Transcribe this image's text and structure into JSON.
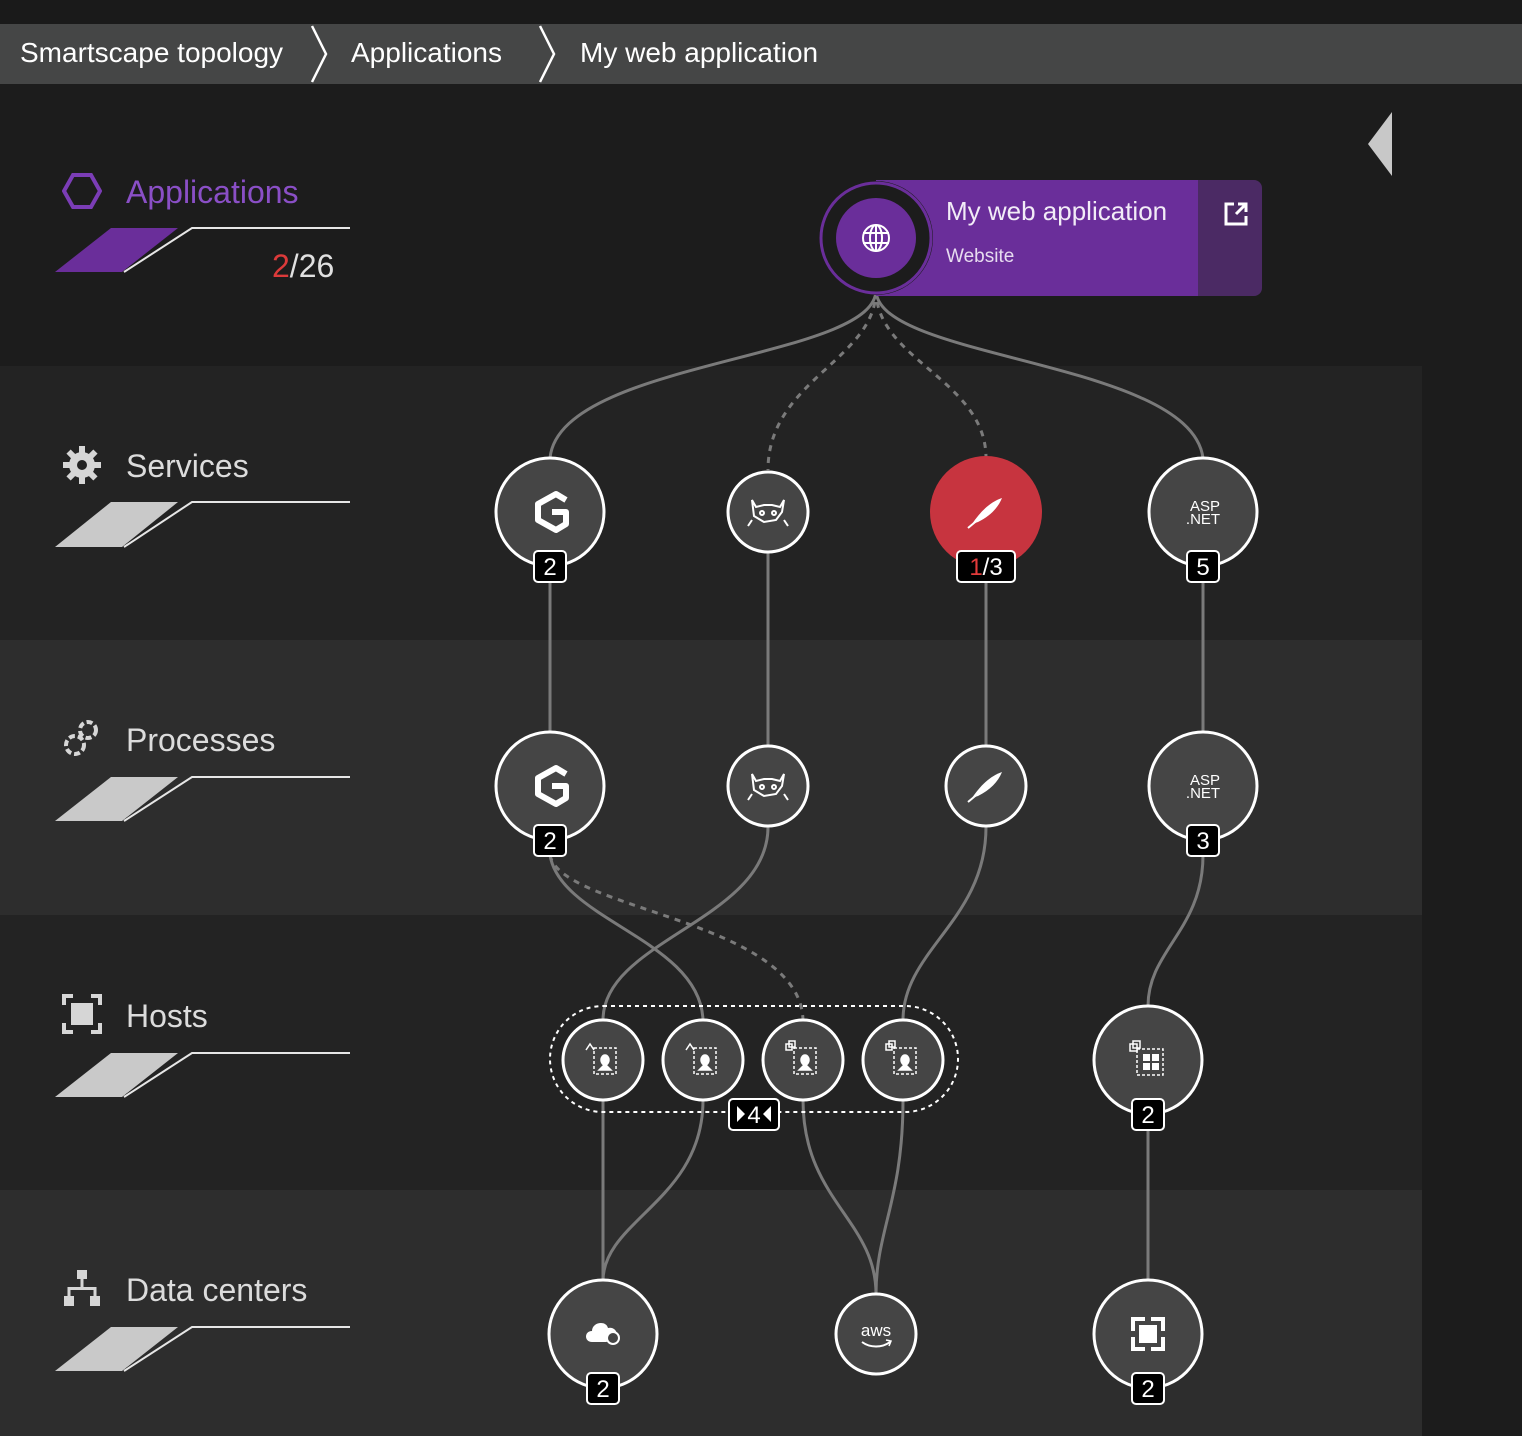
{
  "breadcrumb": {
    "items": [
      "Smartscape topology",
      "Applications",
      "My web application"
    ]
  },
  "colors": {
    "accent_purple": "#6a2e9a",
    "error_red": "#c7343f",
    "node_fill": "#454545"
  },
  "layers": {
    "applications": {
      "label": "Applications",
      "count_error": "2",
      "count_total": "/26",
      "icon": "hexagon-icon"
    },
    "services": {
      "label": "Services",
      "icon": "gear-icon"
    },
    "processes": {
      "label": "Processes",
      "icon": "processes-icon"
    },
    "hosts": {
      "label": "Hosts",
      "icon": "host-icon"
    },
    "datacenters": {
      "label": "Data centers",
      "icon": "datacenter-icon"
    }
  },
  "application": {
    "name": "My web application",
    "type": "Website",
    "icon": "globe-icon",
    "action_icon": "external-link-icon"
  },
  "services": [
    {
      "icon": "nginx-icon",
      "badge": "2"
    },
    {
      "icon": "tomcat-icon",
      "badge": ""
    },
    {
      "icon": "apache-feather-icon",
      "badge_error": "1",
      "badge_total": "/3",
      "status": "error"
    },
    {
      "icon": "aspnet-icon",
      "text": "ASP\n.NET",
      "badge": "5"
    }
  ],
  "processes": [
    {
      "icon": "nginx-icon",
      "badge": "2"
    },
    {
      "icon": "tomcat-icon",
      "badge": ""
    },
    {
      "icon": "apache-feather-icon",
      "badge": ""
    },
    {
      "icon": "aspnet-icon",
      "text": "ASP\n.NET",
      "badge": "3"
    }
  ],
  "hosts": {
    "group_badge": "4",
    "items": [
      {
        "icon": "linux-host-icon"
      },
      {
        "icon": "linux-host-icon"
      },
      {
        "icon": "linux-host-icon"
      },
      {
        "icon": "linux-host-icon"
      },
      {
        "icon": "windows-host-icon",
        "badge": "2"
      }
    ]
  },
  "datacenters": [
    {
      "icon": "azure-cloud-icon",
      "badge": "2"
    },
    {
      "icon": "aws-icon",
      "text": "aws"
    },
    {
      "icon": "datacenter-host-icon",
      "badge": "2"
    }
  ]
}
